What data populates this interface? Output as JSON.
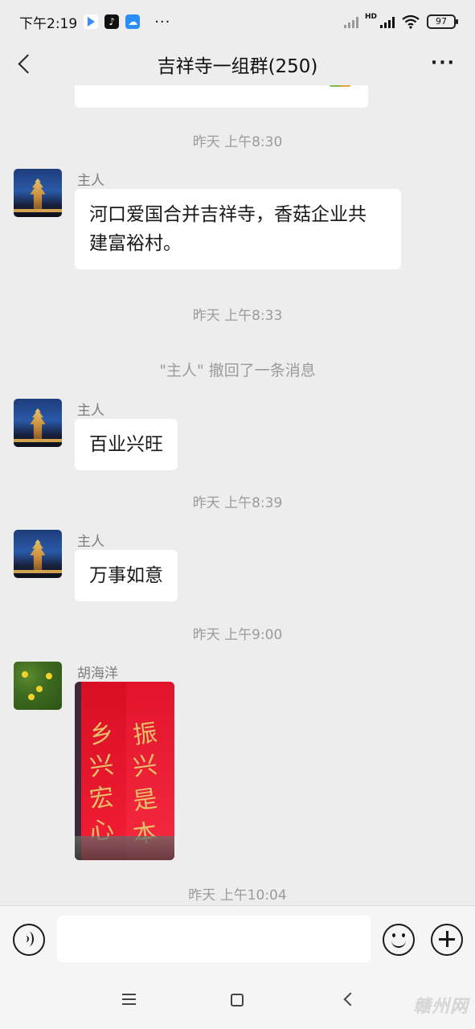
{
  "status_bar": {
    "time": "下午2:19",
    "more": "···",
    "hd": "HD",
    "battery": "97",
    "icons": [
      "play-icon",
      "tiktok-icon",
      "cloud-icon",
      "signal-icon",
      "wifi-icon",
      "battery-icon"
    ]
  },
  "header": {
    "title": "吉祥寺一组群(250)",
    "more": "···"
  },
  "chat": {
    "items": [
      {
        "type": "time",
        "text": "昨天 上午8:30"
      },
      {
        "type": "message",
        "sender": "主人",
        "text_line1": "河口爱国合并吉祥寺，香菇企业共",
        "text_line2": "建富裕村。"
      },
      {
        "type": "time",
        "text": "昨天 上午8:33"
      },
      {
        "type": "system",
        "text": "\"主人\" 撤回了一条消息"
      },
      {
        "type": "message",
        "sender": "主人",
        "text": "百业兴旺"
      },
      {
        "type": "time",
        "text": "昨天 上午8:39"
      },
      {
        "type": "message",
        "sender": "主人",
        "text": "万事如意"
      },
      {
        "type": "time",
        "text": "昨天 上午9:00"
      },
      {
        "type": "image",
        "sender": "胡海洋"
      },
      {
        "type": "time",
        "text": "昨天 上午10:04"
      }
    ]
  },
  "input_bar": {
    "placeholder": ""
  },
  "watermark": "赣州网",
  "colors": {
    "background": "#ededed",
    "bubble": "#ffffff",
    "meta_text": "#9b9b9b"
  }
}
